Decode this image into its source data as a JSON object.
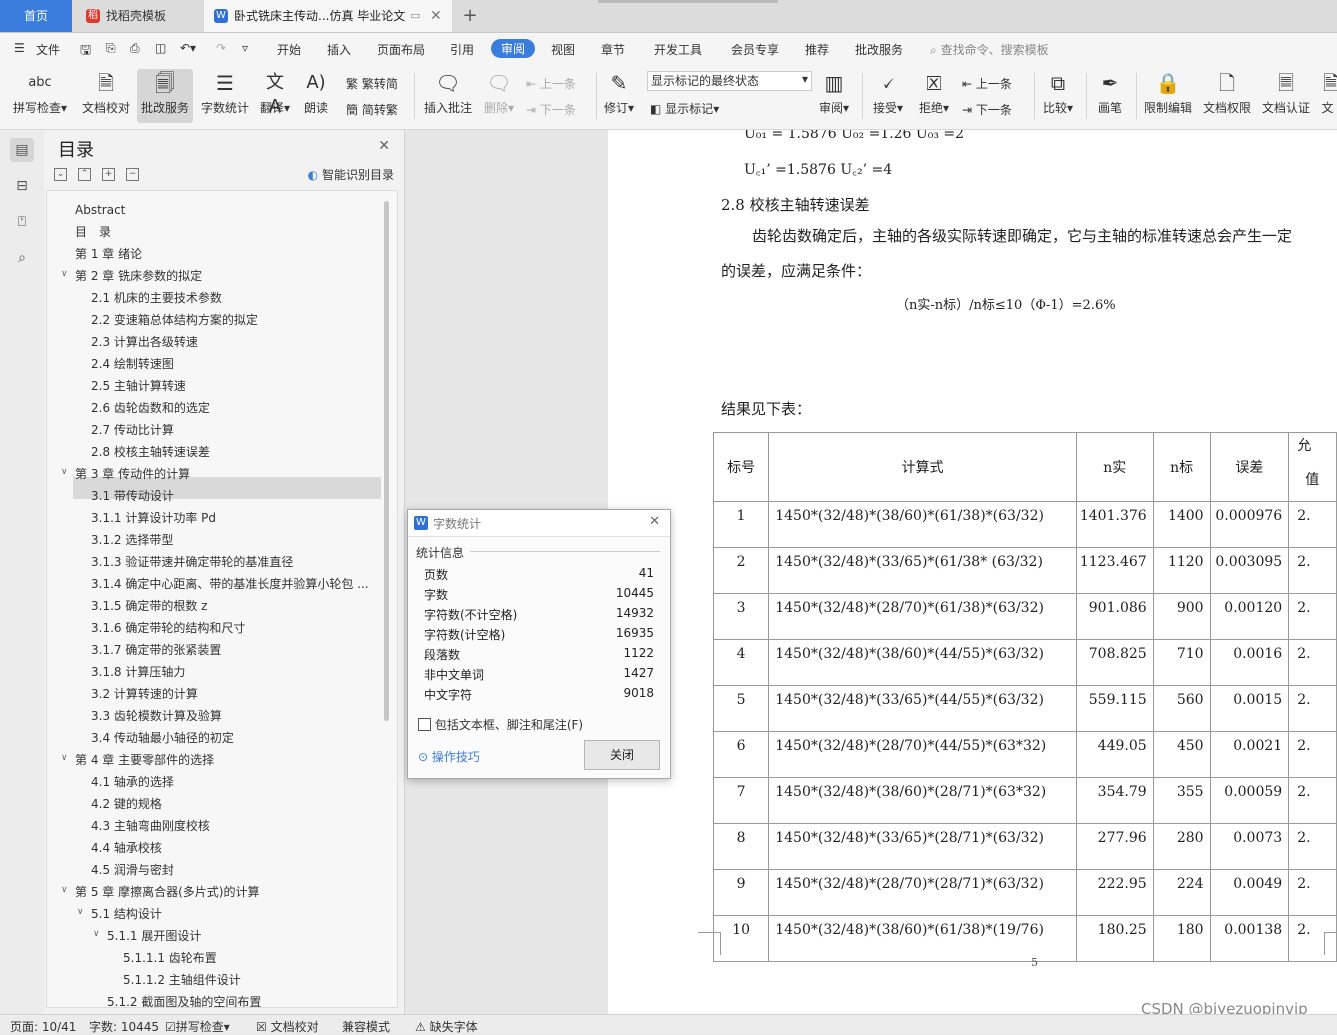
{
  "tabs": {
    "home": "首页",
    "template": "找稻壳模板",
    "document": "卧式铣床主传动...仿真 毕业论文"
  },
  "menu": [
    "文件",
    "开始",
    "插入",
    "页面布局",
    "引用",
    "审阅",
    "视图",
    "章节",
    "开发工具",
    "会员专享",
    "推荐",
    "批改服务"
  ],
  "search_placeholder": "查找命令、搜索模板",
  "ribbon": {
    "spellcheck": "拼写检查",
    "doc_proof": "文档校对",
    "review_service": "批改服务",
    "word_count": "字数统计",
    "translate": "翻译",
    "read_aloud": "朗读",
    "to_traditional": "繁转简",
    "to_simplified": "简转繁",
    "insert_comment": "插入批注",
    "delete": "删除",
    "prev": "上一条",
    "next": "下一条",
    "track": "修订",
    "markup_state": "显示标记的最终状态",
    "show_markup": "显示标记",
    "review": "审阅",
    "accept": "接受",
    "reject": "拒绝",
    "prev2": "上一条",
    "next2": "下一条",
    "compare": "比较",
    "pen": "画笔",
    "restrict_edit": "限制编辑",
    "doc_permission": "文档权限",
    "doc_cert": "文档认证",
    "more": "文"
  },
  "toc": {
    "title": "目录",
    "smart": "智能识别目录",
    "items": [
      "Abstract",
      "目　录",
      "第 1 章  绪论",
      "第 2 章  铣床参数的拟定",
      "2.1 机床的主要技术参数",
      "2.2 变速箱总体结构方案的拟定",
      "2.3 计算出各级转速",
      "2.4 绘制转速图",
      "2.5 主轴计算转速",
      "2.6 齿轮齿数和的选定",
      "2.7 传动比计算",
      "2.8 校核主轴转速误差",
      "第 3 章  传动件的计算",
      "3.1  带传动设计",
      "3.1.1 计算设计功率 Pd",
      "3.1.2 选择带型",
      "3.1.3 验证带速并确定带轮的基准直径",
      "3.1.4 确定中心距离、带的基准长度并验算小轮包 ...",
      "3.1.5 确定带的根数 z",
      "3.1.6 确定带轮的结构和尺寸",
      "3.1.7 确定带的张紧装置",
      "3.1.8 计算压轴力",
      "3.2  计算转速的计算",
      "3.3  齿轮模数计算及验算",
      "3.4  传动轴最小轴径的初定",
      "第 4 章  主要零部件的选择",
      "4.1  轴承的选择",
      "4.2  键的规格",
      "4.3  主轴弯曲刚度校核",
      "4.4  轴承校核",
      "4.5  润滑与密封",
      "第 5 章   摩擦离合器(多片式)的计算",
      "5.1  结构设计",
      "5.1.1   展开图设计",
      "5.1.1.1   齿轮布置",
      "5.1.1.2  主轴组件设计",
      "5.1.2  截面图及轴的空间布置"
    ]
  },
  "document": {
    "eq_line1": "U₀₁  = 1.5876    U₀₂  =1.26      U₀₃  =2",
    "eq_line2": "U꜀₁’ =1.5876    U꜀₂’ =4",
    "section": "2.8 校核主轴转速误差",
    "para1": "齿轮齿数确定后，主轴的各级实际转速即确定，它与主轴的标准转速总会产生一定",
    "para2": "的误差，应满足条件：",
    "formula": "（n实-n标）/n标≤10（Φ-1）=2.6%",
    "result": "结果见下表：",
    "page_number": "5",
    "table": {
      "headers": [
        "标号",
        "计算式",
        "n实",
        "n标",
        "误差",
        "允"
      ],
      "header_extra": "值",
      "rows": [
        [
          "1",
          "1450*(32/48)*(38/60)*(61/38)*(63/32)",
          "1401.376",
          "1400",
          "0.000976",
          "2."
        ],
        [
          "2",
          "1450*(32/48)*(33/65)*(61/38* (63/32)",
          "1123.467",
          "1120",
          "0.003095",
          "2."
        ],
        [
          "3",
          "1450*(32/48)*(28/70)*(61/38)*(63/32)",
          "901.086",
          "900",
          "0.00120",
          "2."
        ],
        [
          "4",
          "1450*(32/48)*(38/60)*(44/55)*(63/32)",
          "708.825",
          "710",
          "0.0016",
          "2."
        ],
        [
          "5",
          "1450*(32/48)*(33/65)*(44/55)*(63/32)",
          "559.115",
          "560",
          "0.0015",
          "2."
        ],
        [
          "6",
          "1450*(32/48)*(28/70)*(44/55)*(63*32)",
          "449.05",
          "450",
          "0.0021",
          "2."
        ],
        [
          "7",
          "1450*(32/48)*(38/60)*(28/71)*(63*32)",
          "354.79",
          "355",
          "0.00059",
          "2."
        ],
        [
          "8",
          "1450*(32/48)*(33/65)*(28/71)*(63/32)",
          "277.96",
          "280",
          "0.0073",
          "2."
        ],
        [
          "9",
          "1450*(32/48)*(28/70)*(28/71)*(63/32)",
          "222.95",
          "224",
          "0.0049",
          "2."
        ],
        [
          "10",
          "1450*(32/48)*(38/60)*(61/38)*(19/76)",
          "180.25",
          "180",
          "0.00138",
          "2."
        ]
      ]
    }
  },
  "dialog": {
    "title": "字数统计",
    "group": "统计信息",
    "stats": [
      {
        "label": "页数",
        "value": "41"
      },
      {
        "label": "字数",
        "value": "10445"
      },
      {
        "label": "字符数(不计空格)",
        "value": "14932"
      },
      {
        "label": "字符数(计空格)",
        "value": "16935"
      },
      {
        "label": "段落数",
        "value": "1122"
      },
      {
        "label": "非中文单词",
        "value": "1427"
      },
      {
        "label": "中文字符",
        "value": "9018"
      }
    ],
    "checkbox": "包括文本框、脚注和尾注(F)",
    "tips": "操作技巧",
    "close": "关闭"
  },
  "status": {
    "page": "页面: 10/41",
    "words": "字数: 10445",
    "spell": "拼写检查",
    "proof": "文档校对",
    "compat": "兼容模式",
    "missing_font": "缺失字体"
  },
  "watermark": "CSDN @biyezuopinvip",
  "colors": {
    "accent": "#3b7ddd",
    "tab_active_bg": "#f6f6f6",
    "page_bg": "#ffffff"
  }
}
